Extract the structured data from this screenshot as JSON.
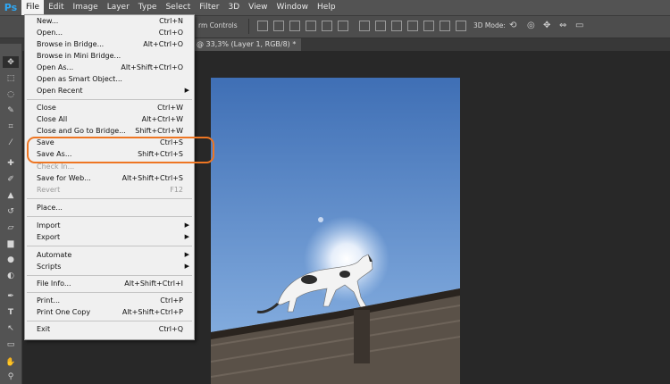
{
  "app": {
    "logo": "Ps"
  },
  "menubar": {
    "items": [
      "File",
      "Edit",
      "Image",
      "Layer",
      "Type",
      "Select",
      "Filter",
      "3D",
      "View",
      "Window",
      "Help"
    ]
  },
  "options_bar": {
    "transform_controls_fragment": "rm Controls",
    "mode_label": "3D Mode:"
  },
  "document_tab": {
    "title": "@ 33,3% (Layer 1, RGB/8) *"
  },
  "file_menu": {
    "new": {
      "label": "New...",
      "shortcut": "Ctrl+N"
    },
    "open": {
      "label": "Open...",
      "shortcut": "Ctrl+O"
    },
    "browse_bridge": {
      "label": "Browse in Bridge...",
      "shortcut": "Alt+Ctrl+O"
    },
    "browse_mini_bridge": {
      "label": "Browse in Mini Bridge..."
    },
    "open_as": {
      "label": "Open As...",
      "shortcut": "Alt+Shift+Ctrl+O"
    },
    "open_smart": {
      "label": "Open as Smart Object..."
    },
    "open_recent": {
      "label": "Open Recent"
    },
    "close": {
      "label": "Close",
      "shortcut": "Ctrl+W"
    },
    "close_all": {
      "label": "Close All",
      "shortcut": "Alt+Ctrl+W"
    },
    "close_go_bridge": {
      "label": "Close and Go to Bridge...",
      "shortcut": "Shift+Ctrl+W"
    },
    "save": {
      "label": "Save",
      "shortcut": "Ctrl+S"
    },
    "save_as": {
      "label": "Save As...",
      "shortcut": "Shift+Ctrl+S"
    },
    "check_in": {
      "label": "Check In..."
    },
    "save_web": {
      "label": "Save for Web...",
      "shortcut": "Alt+Shift+Ctrl+S"
    },
    "revert": {
      "label": "Revert",
      "shortcut": "F12"
    },
    "place": {
      "label": "Place..."
    },
    "import": {
      "label": "Import"
    },
    "export": {
      "label": "Export"
    },
    "automate": {
      "label": "Automate"
    },
    "scripts": {
      "label": "Scripts"
    },
    "file_info": {
      "label": "File Info...",
      "shortcut": "Alt+Shift+Ctrl+I"
    },
    "print": {
      "label": "Print...",
      "shortcut": "Ctrl+P"
    },
    "print_one": {
      "label": "Print One Copy",
      "shortcut": "Alt+Shift+Ctrl+P"
    },
    "exit": {
      "label": "Exit",
      "shortcut": "Ctrl+Q"
    }
  },
  "colors": {
    "highlight": "#ee7623",
    "sky_top": "#3f6fb5",
    "sky_bottom": "#8fb7e6"
  }
}
